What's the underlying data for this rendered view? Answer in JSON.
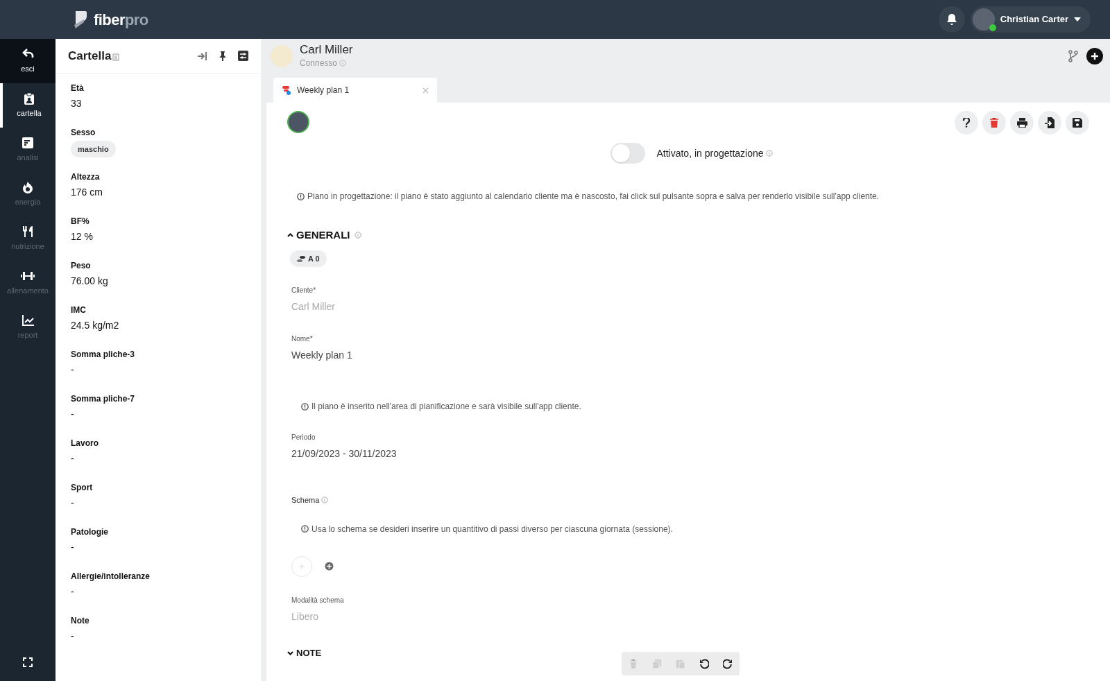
{
  "topbar": {
    "logo": {
      "part_1": "fiber",
      "part_2": "pro"
    },
    "user": {
      "name": "Christian Carter",
      "online": true
    }
  },
  "nav": [
    {
      "kind": "back",
      "label": "esci",
      "selected": false
    },
    {
      "kind": "clipboard",
      "label": "cartella",
      "selected": true
    },
    {
      "kind": "analysis",
      "label": "analisi",
      "selected": false
    },
    {
      "kind": "flame",
      "label": "energia",
      "selected": false
    },
    {
      "kind": "cutlery",
      "label": "nutrizione",
      "selected": false
    },
    {
      "kind": "dumbbell",
      "label": "allenamento",
      "selected": false
    },
    {
      "kind": "chart",
      "label": "report",
      "selected": false
    }
  ],
  "record_panel": {
    "title": "Cartella",
    "fields": [
      {
        "label": "Età",
        "value": "33",
        "kind": "text"
      },
      {
        "label": "Sesso",
        "value": "maschio",
        "kind": "chip"
      },
      {
        "label": "Altezza",
        "value": "176 cm",
        "kind": "text"
      },
      {
        "label": "BF%",
        "value": "12 %",
        "kind": "text"
      },
      {
        "label": "Peso",
        "value": "76.00 kg",
        "kind": "text"
      },
      {
        "label": "IMC",
        "value": "24.5 kg/m2",
        "kind": "text"
      },
      {
        "label": "Somma pliche-3",
        "value": "-",
        "kind": "text"
      },
      {
        "label": "Somma pliche-7",
        "value": "-",
        "kind": "text"
      },
      {
        "label": "Lavoro",
        "value": "-",
        "kind": "text"
      },
      {
        "label": "Sport",
        "value": "-",
        "kind": "text"
      },
      {
        "label": "Patologie",
        "value": "-",
        "kind": "text"
      },
      {
        "label": "Allergie/intolleranze",
        "value": "-",
        "kind": "text"
      },
      {
        "label": "Note",
        "value": "-",
        "kind": "text"
      }
    ]
  },
  "client_header": {
    "name": "Carl Miller",
    "status": "Connesso"
  },
  "tabs": [
    {
      "label": "Weekly plan 1",
      "selected": true
    }
  ],
  "plan": {
    "toggle": {
      "label": "Attivato, in progettazione",
      "on": false
    },
    "design_notice": "Piano in progettazione: il piano è stato aggiunto al calendario cliente ma è nascosto, fai click sul pulsante sopra e salva per renderlo visibile sull'app cliente.",
    "section_general": {
      "title": "GENERALI",
      "expanded": true
    },
    "badge": "A 0",
    "client": {
      "label": "Cliente*",
      "value": "Carl Miller",
      "disabled": true
    },
    "name": {
      "label": "Nome*",
      "value": "Weekly plan 1",
      "disabled": false
    },
    "name_notice": "Il piano è inserito nell'area di pianificazione e sarà visibile sull'app cliente.",
    "period": {
      "label": "Periodo",
      "value": "21/09/2023 - 30/11/2023",
      "disabled": false
    },
    "schema_label": "Schema",
    "schema_notice": "Usa lo schema se desideri inserire un quantitivo di passi diverso per ciascuna giornata (sessione).",
    "schema_mode": {
      "label": "Modalità schema",
      "value": "Libero",
      "disabled": true
    },
    "section_notes": {
      "title": "NOTE",
      "expanded": false
    }
  },
  "edit_toolbar": [
    {
      "kind": "trash",
      "disabled": true
    },
    {
      "kind": "copy",
      "disabled": true
    },
    {
      "kind": "paste",
      "disabled": true
    },
    {
      "kind": "undo",
      "disabled": false
    },
    {
      "kind": "redo",
      "disabled": false
    }
  ]
}
